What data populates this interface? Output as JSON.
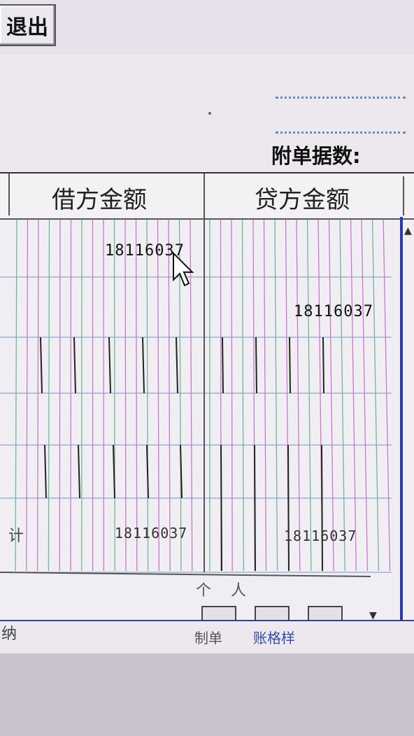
{
  "toolbar": {
    "exit_label": "退出"
  },
  "form": {
    "attachments_label": "附单据数:"
  },
  "columns": {
    "debit_header": "借方金额",
    "credit_header": "贷方金额"
  },
  "rows": [
    {
      "debit": "18116037",
      "credit": ""
    },
    {
      "debit": "",
      "credit": "18116037"
    }
  ],
  "totals": {
    "label": "计",
    "debit": "18116037",
    "credit": "18116037"
  },
  "signature": {
    "personal": "个人"
  },
  "footer": {
    "left_glyph": "纳",
    "maker_label": "制单",
    "template_label": "账格样"
  },
  "colors": {
    "grid_pink": "#c678c8",
    "grid_green": "#6fb59a",
    "grid_blue": "#9bb3d6",
    "frame_blue": "#2b3aa8"
  }
}
